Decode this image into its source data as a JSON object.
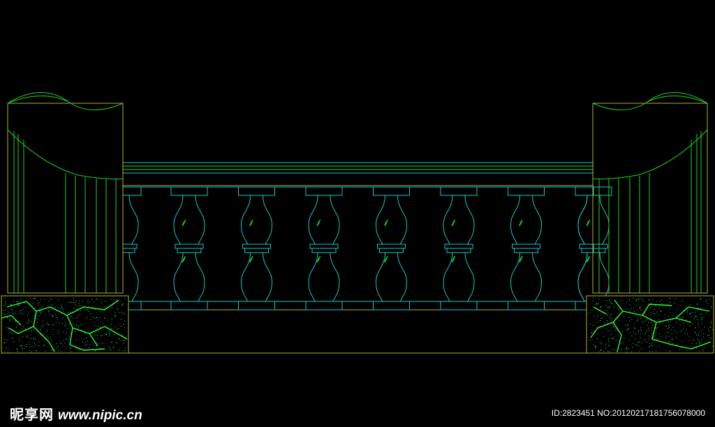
{
  "watermark": {
    "brand": "昵享网",
    "site": "www.nipic.cn",
    "image_id_text": "ID:2823451 NO:20120217181756078000"
  },
  "colors": {
    "background": "#000000",
    "outline": "#b5b52a",
    "cad_green": "#1fd41f",
    "cad_cyan": "#19c9c9",
    "marble_green": "#31ff31"
  },
  "drawing": {
    "baluster_count": 7,
    "has_half_balusters_at_ends": true,
    "pillars": [
      "left-pillar",
      "right-pillar"
    ]
  }
}
